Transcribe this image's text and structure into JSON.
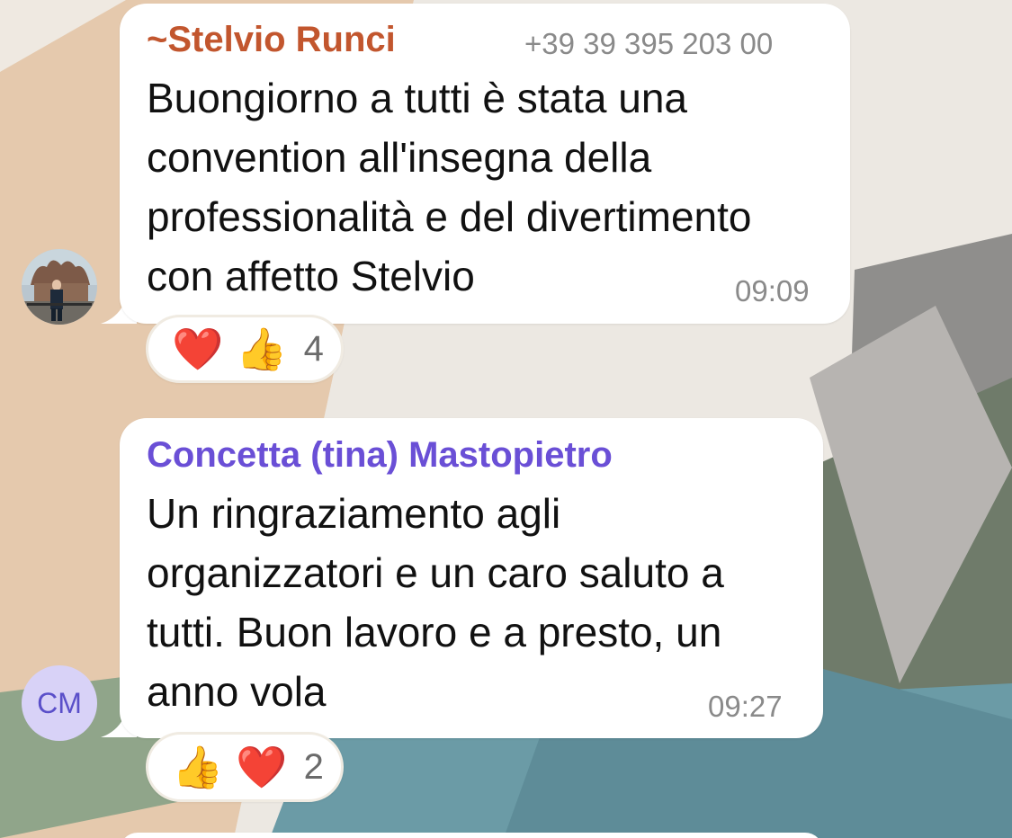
{
  "messages": [
    {
      "sender": "~Stelvio Runci",
      "sender_color": "#c2562e",
      "phone": "+39 39 395 203 00",
      "lines": [
        "Buongiorno a tutti è stata una",
        "convention all'insegna della",
        "professionalità e del divertimento",
        "con affetto Stelvio"
      ],
      "time": "09:09",
      "avatar": "profile-photo",
      "reactions": {
        "emojis": [
          "❤️",
          "👍"
        ],
        "icons": [
          "red-heart-icon",
          "thumbs-up-icon"
        ],
        "count": "4"
      }
    },
    {
      "sender": "Concetta (tina) Mastopietro",
      "sender_color": "#6a4fd6",
      "lines": [
        "Un ringraziamento agli",
        "organizzatori e un caro saluto a",
        "tutti. Buon lavoro e a presto, un",
        "anno vola"
      ],
      "time": "09:27",
      "avatar_initials": "CM",
      "reactions": {
        "emojis": [
          "👍",
          "❤️"
        ],
        "icons": [
          "thumbs-up-icon",
          "red-heart-icon"
        ],
        "count": "2"
      }
    }
  ]
}
